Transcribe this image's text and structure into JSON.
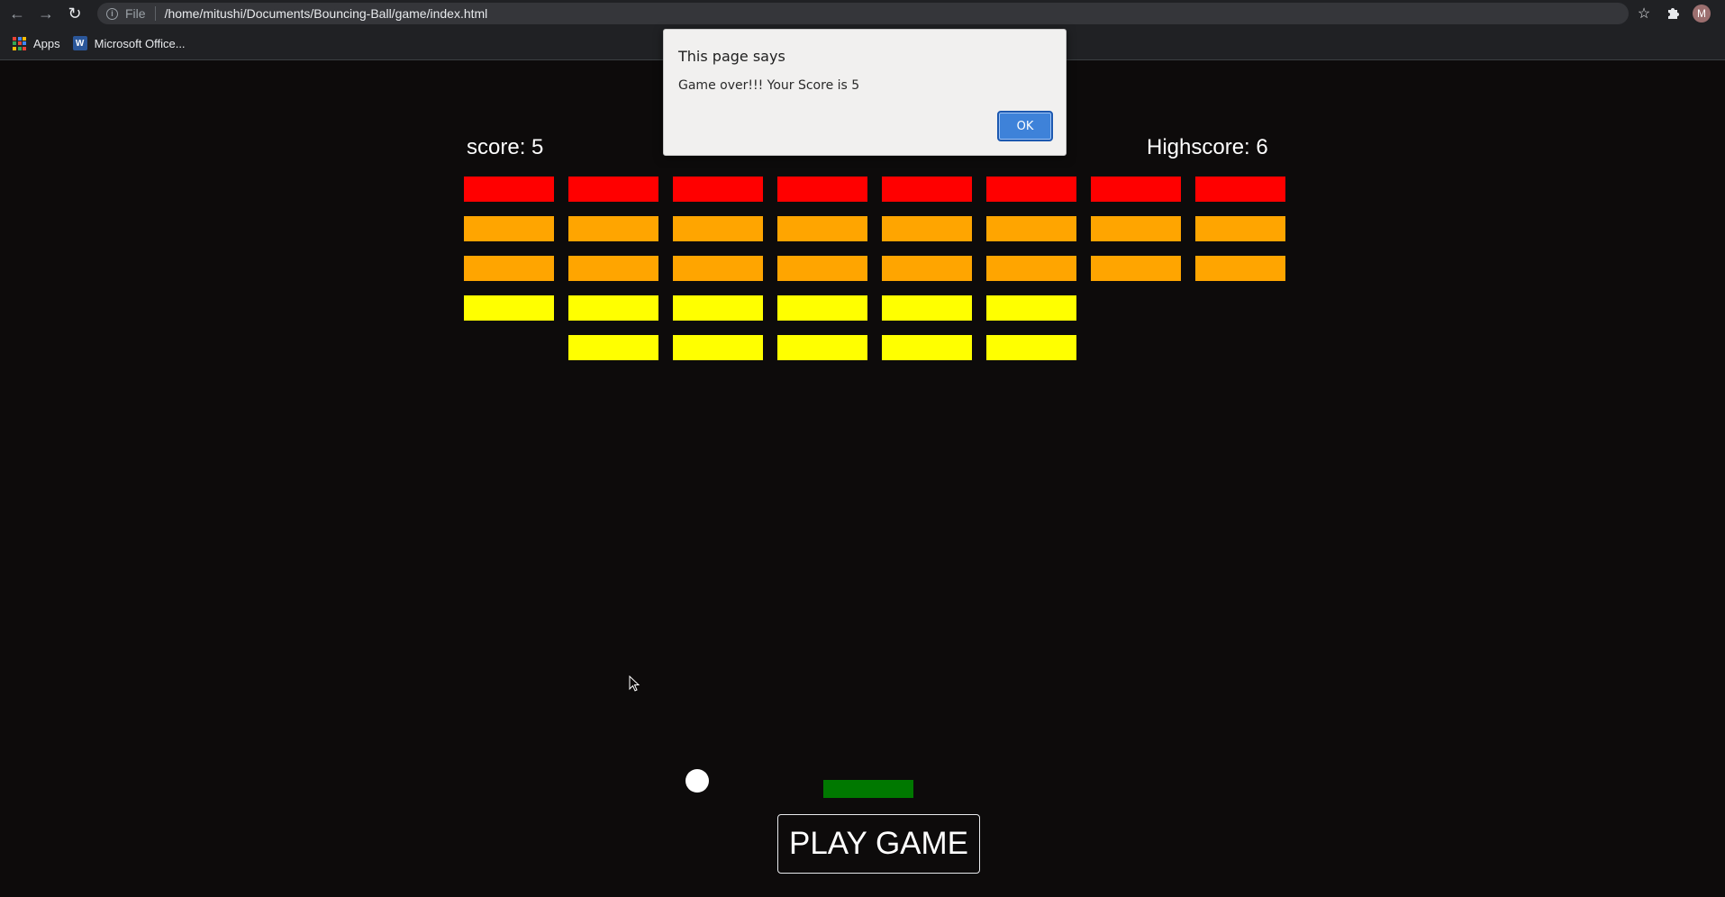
{
  "browser": {
    "url_scheme": "File",
    "url": "/home/mitushi/Documents/Bouncing-Ball/game/index.html",
    "avatar_letter": "M",
    "bookmarks": [
      {
        "label": "Apps",
        "icon": "apps-grid-icon"
      },
      {
        "label": "Microsoft Office...",
        "icon": "word-icon"
      }
    ]
  },
  "game": {
    "score_label": "score: 5",
    "highscore_label": "Highscore: 6",
    "play_button_label": "PLAY GAME",
    "colors": {
      "red": "#ff0000",
      "orange": "#ffa500",
      "yellow": "#ffff00",
      "paddle": "#007800",
      "ball": "#ffffff"
    },
    "brick_rows": [
      {
        "color": "red",
        "columns": [
          1,
          1,
          1,
          1,
          1,
          1,
          1,
          1
        ]
      },
      {
        "color": "orange",
        "columns": [
          1,
          1,
          1,
          1,
          1,
          1,
          1,
          1
        ]
      },
      {
        "color": "orange",
        "columns": [
          1,
          1,
          1,
          1,
          1,
          1,
          1,
          1
        ]
      },
      {
        "color": "yellow",
        "columns": [
          1,
          1,
          1,
          1,
          1,
          1,
          0,
          0
        ]
      },
      {
        "color": "yellow",
        "columns": [
          0,
          1,
          1,
          1,
          1,
          1,
          0,
          0
        ]
      }
    ]
  },
  "dialog": {
    "title": "This page says",
    "message": "Game over!!! Your Score is 5",
    "ok_label": "OK"
  }
}
